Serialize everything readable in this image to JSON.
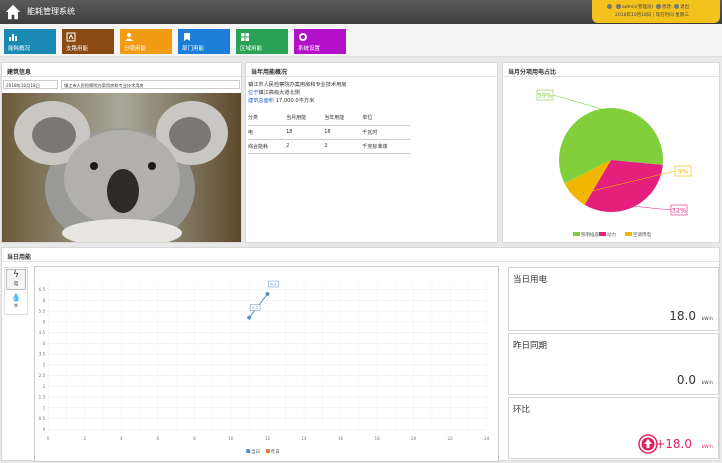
{
  "header": {
    "title": "能耗管理系统",
    "user": "admin(管理员)",
    "edit": "修改",
    "logout": "退出",
    "date": "2018年10月18日 | 现在时间  星期三"
  },
  "menu": [
    {
      "label": "能耗概况",
      "color": "#1a8ab5",
      "icon": "chart-icon"
    },
    {
      "label": "支路用能",
      "color": "#8b4a12",
      "icon": "branch-icon"
    },
    {
      "label": "分项用能",
      "color": "#f29c13",
      "icon": "users-icon"
    },
    {
      "label": "部门用能",
      "color": "#1c7ed6",
      "icon": "bookmark-icon"
    },
    {
      "label": "区域用能",
      "color": "#2aa256",
      "icon": "grid-icon"
    },
    {
      "label": "系统设置",
      "color": "#b310c9",
      "icon": "settings-icon"
    }
  ],
  "building": {
    "title": "建筑信息",
    "date": "2018年10月18日",
    "select": "镇江市人民检察院办案用房和专业技术用房"
  },
  "year": {
    "title": "当年用能概况",
    "name": "镇江市人民检察院办案用房和专业技术用房",
    "location_label": "位于",
    "location": "镇江高级大道北侧",
    "area_label": "建筑总面积",
    "area": "17,000.0平方米",
    "headers": [
      "分类",
      "当月用能",
      "当年用能",
      "单位"
    ],
    "rows": [
      [
        "电",
        "18",
        "18",
        "千瓦时"
      ],
      [
        "综合能耗",
        "2",
        "2",
        "千克标准煤"
      ]
    ]
  },
  "pie_panel": {
    "title": "当月分项用电占比"
  },
  "chart_data": [
    {
      "type": "pie",
      "slices": [
        {
          "name": "照明插座",
          "value": 59,
          "label": "59%",
          "color": "#82cf3c"
        },
        {
          "name": "动力",
          "value": 32,
          "label": "32%",
          "color": "#e51f7c"
        },
        {
          "name": "空调用电",
          "value": 9,
          "label": "9%",
          "color": "#f3b600"
        }
      ]
    },
    {
      "type": "line",
      "ylim": [
        0,
        7
      ],
      "yticks": [
        "0",
        "0.5",
        "1",
        "1.5",
        "2",
        "2.5",
        "3",
        "3.5",
        "4",
        "4.5",
        "5",
        "5.5",
        "6",
        "6.5"
      ],
      "xticks": [
        "0",
        "2",
        "4",
        "6",
        "8",
        "10",
        "12",
        "14",
        "16",
        "18",
        "20",
        "22",
        "24"
      ],
      "series": [
        {
          "name": "当日",
          "x": [
            11,
            12
          ],
          "y": [
            5.2,
            6.3
          ],
          "labels": [
            "5.2",
            "6.3"
          ],
          "color": "#5b8ec9"
        },
        {
          "name": "昨日",
          "x": [],
          "y": [],
          "color": "#e8763a"
        }
      ]
    }
  ],
  "daily": {
    "title": "当日用能",
    "tab_elec": "电",
    "tab_water": "水"
  },
  "stats": [
    {
      "label": "当日用电",
      "value": "18.0",
      "unit": "kW·h"
    },
    {
      "label": "昨日同期",
      "value": "0.0",
      "unit": "kW·h"
    },
    {
      "label": "环比",
      "value": "+18.0",
      "unit": "kW·h"
    }
  ]
}
